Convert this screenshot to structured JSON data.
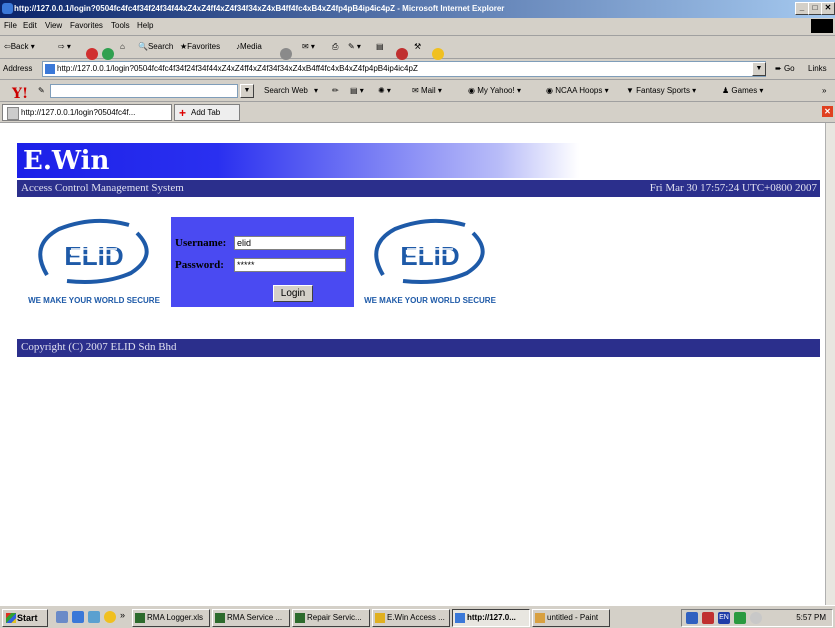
{
  "window": {
    "title": "http://127.0.0.1/login?0504fc4fc4f34f24f34f44xZ4xZ4ff4xZ4f34f34xZ4xB4ff4fc4xB4xZ4fp4pB4ip4ic4pZ - Microsoft Internet Explorer",
    "min": "_",
    "max": "□",
    "close": "✕"
  },
  "menu": [
    "File",
    "Edit",
    "View",
    "Favorites",
    "Tools",
    "Help"
  ],
  "toolbar": {
    "back": "Back",
    "search": "Search",
    "favorites": "Favorites",
    "media": "Media"
  },
  "address": {
    "label": "Address",
    "url": "http://127.0.0.1/login?0504fc4fc4f34f24f34f44xZ4xZ4ff4xZ4f34f34xZ4xB4ff4fc4xB4xZ4fp4pB4ip4ic4pZ",
    "go": "Go",
    "links": "Links"
  },
  "yahoo": {
    "logo": "Y!",
    "search_web": "Search Web",
    "mail": "Mail",
    "my_yahoo": "My Yahoo!",
    "ncaa": "NCAA Hoops",
    "fantasy": "Fantasy Sports",
    "games": "Games",
    "more": "»"
  },
  "tabs": {
    "active": "http://127.0.0.1/login?0504fc4f...",
    "add": "Add Tab"
  },
  "page": {
    "brand": "E.Win",
    "subtitle": "Access Control Management System",
    "datetime": "Fri Mar 30 17:57:24 UTC+0800 2007",
    "logo_text": "ELID",
    "logo_caption": "WE MAKE YOUR WORLD SECURE",
    "username_label": "Username:",
    "username_value": "elid",
    "password_label": "Password:",
    "password_value": "*****",
    "login_button": "Login",
    "copyright": "Copyright (C) 2007 ELID Sdn Bhd"
  },
  "taskbar": {
    "start": "Start",
    "more": "»",
    "tasks": [
      "RMA Logger.xls",
      "RMA Service ...",
      "Repair Servic...",
      "E.Win Access ...",
      "http://127.0...",
      "untitled - Paint"
    ],
    "tray_lang": "EN",
    "clock": "5:57 PM"
  },
  "colors": {
    "banner_blue": "#1c20e8",
    "bar_navy": "#2b2f8c",
    "login_box": "#4a4af2",
    "logo_blue": "#1e5aa8"
  }
}
